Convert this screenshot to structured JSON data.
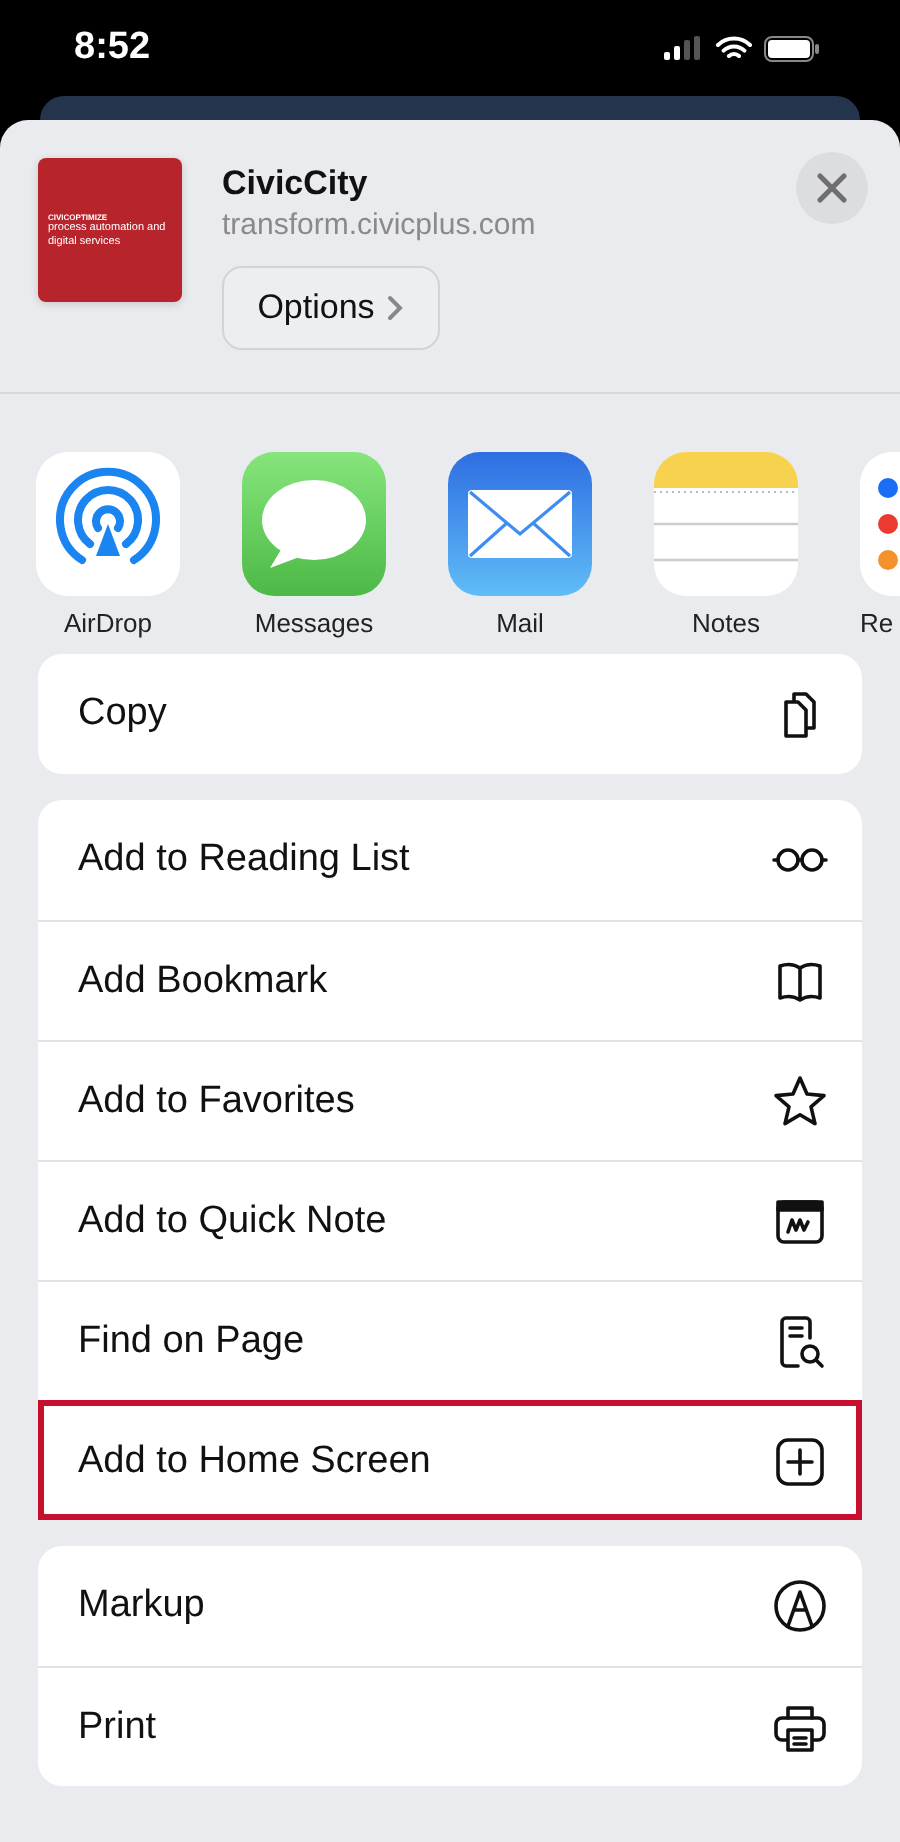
{
  "status_bar": {
    "time": "8:52"
  },
  "header": {
    "thumbnail": {
      "brand": "CIVICOPTIMIZE",
      "tagline": "process automation and digital services"
    },
    "title": "CivicCity",
    "url": "transform.civicplus.com",
    "options_button": "Options"
  },
  "apps": [
    {
      "label": "AirDrop"
    },
    {
      "label": "Messages"
    },
    {
      "label": "Mail"
    },
    {
      "label": "Notes"
    },
    {
      "label": "Re"
    }
  ],
  "action_groups": [
    [
      {
        "label": "Copy",
        "highlighted": false
      }
    ],
    [
      {
        "label": "Add to Reading List",
        "highlighted": false
      },
      {
        "label": "Add Bookmark",
        "highlighted": false
      },
      {
        "label": "Add to Favorites",
        "highlighted": false
      },
      {
        "label": "Add to Quick Note",
        "highlighted": false
      },
      {
        "label": "Find on Page",
        "highlighted": false
      },
      {
        "label": "Add to Home Screen",
        "highlighted": true
      }
    ],
    [
      {
        "label": "Markup",
        "highlighted": false
      },
      {
        "label": "Print",
        "highlighted": false
      }
    ]
  ]
}
